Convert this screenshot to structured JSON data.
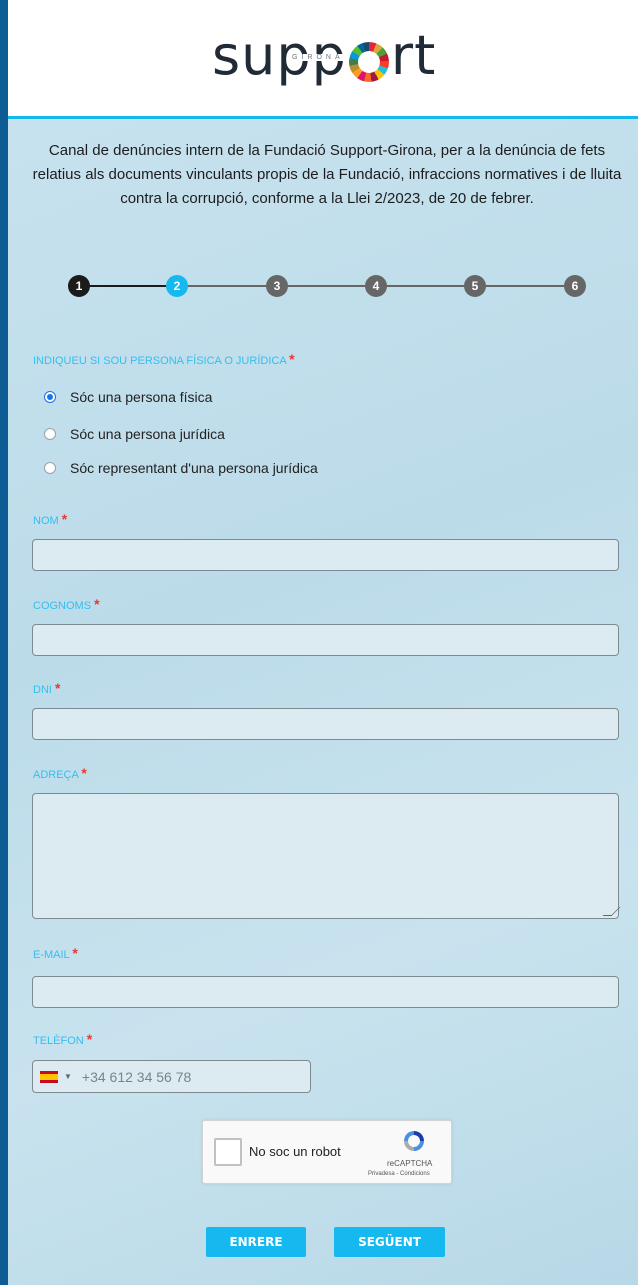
{
  "header": {
    "logo_text_left": "supp",
    "logo_text_right": "rt",
    "logo_subtext": "GIRONA"
  },
  "intro": "Canal de denúncies intern de la Fundació Support-Girona, per a la denúncia de fets relatius als documents vinculants propis de la Fundació, infraccions normatives i de lluita contra la corrupció, conforme a la Llei 2/2023, de 20 de febrer.",
  "stepper": {
    "steps": [
      "1",
      "2",
      "3",
      "4",
      "5",
      "6"
    ],
    "current": 2
  },
  "person_type": {
    "label": "INDIQUEU SI SOU PERSONA FÍSICA O JURÍDICA",
    "options": [
      "Sóc una persona física",
      "Sóc una persona jurídica",
      "Sóc representant d'una persona jurídica"
    ],
    "selected": 0
  },
  "fields": {
    "nom": {
      "label": "NOM",
      "value": ""
    },
    "cognoms": {
      "label": "COGNOMS",
      "value": ""
    },
    "dni": {
      "label": "DNI",
      "value": ""
    },
    "adreca": {
      "label": "ADREÇA",
      "value": ""
    },
    "email": {
      "label": "E-MAIL",
      "value": ""
    },
    "telefon": {
      "label": "TELÈFON",
      "placeholder": "+34 612 34 56 78"
    }
  },
  "required_mark": "*",
  "captcha": {
    "label": "No soc un robot",
    "brand": "reCAPTCHA",
    "links": "Privadesa - Condicions"
  },
  "buttons": {
    "back": "ENRERE",
    "next": "SEGÜENT"
  },
  "colors": {
    "accent": "#16b8f0",
    "frame": "#0d5d94",
    "step_done": "#1b1b1b",
    "step_pending": "#666666"
  }
}
